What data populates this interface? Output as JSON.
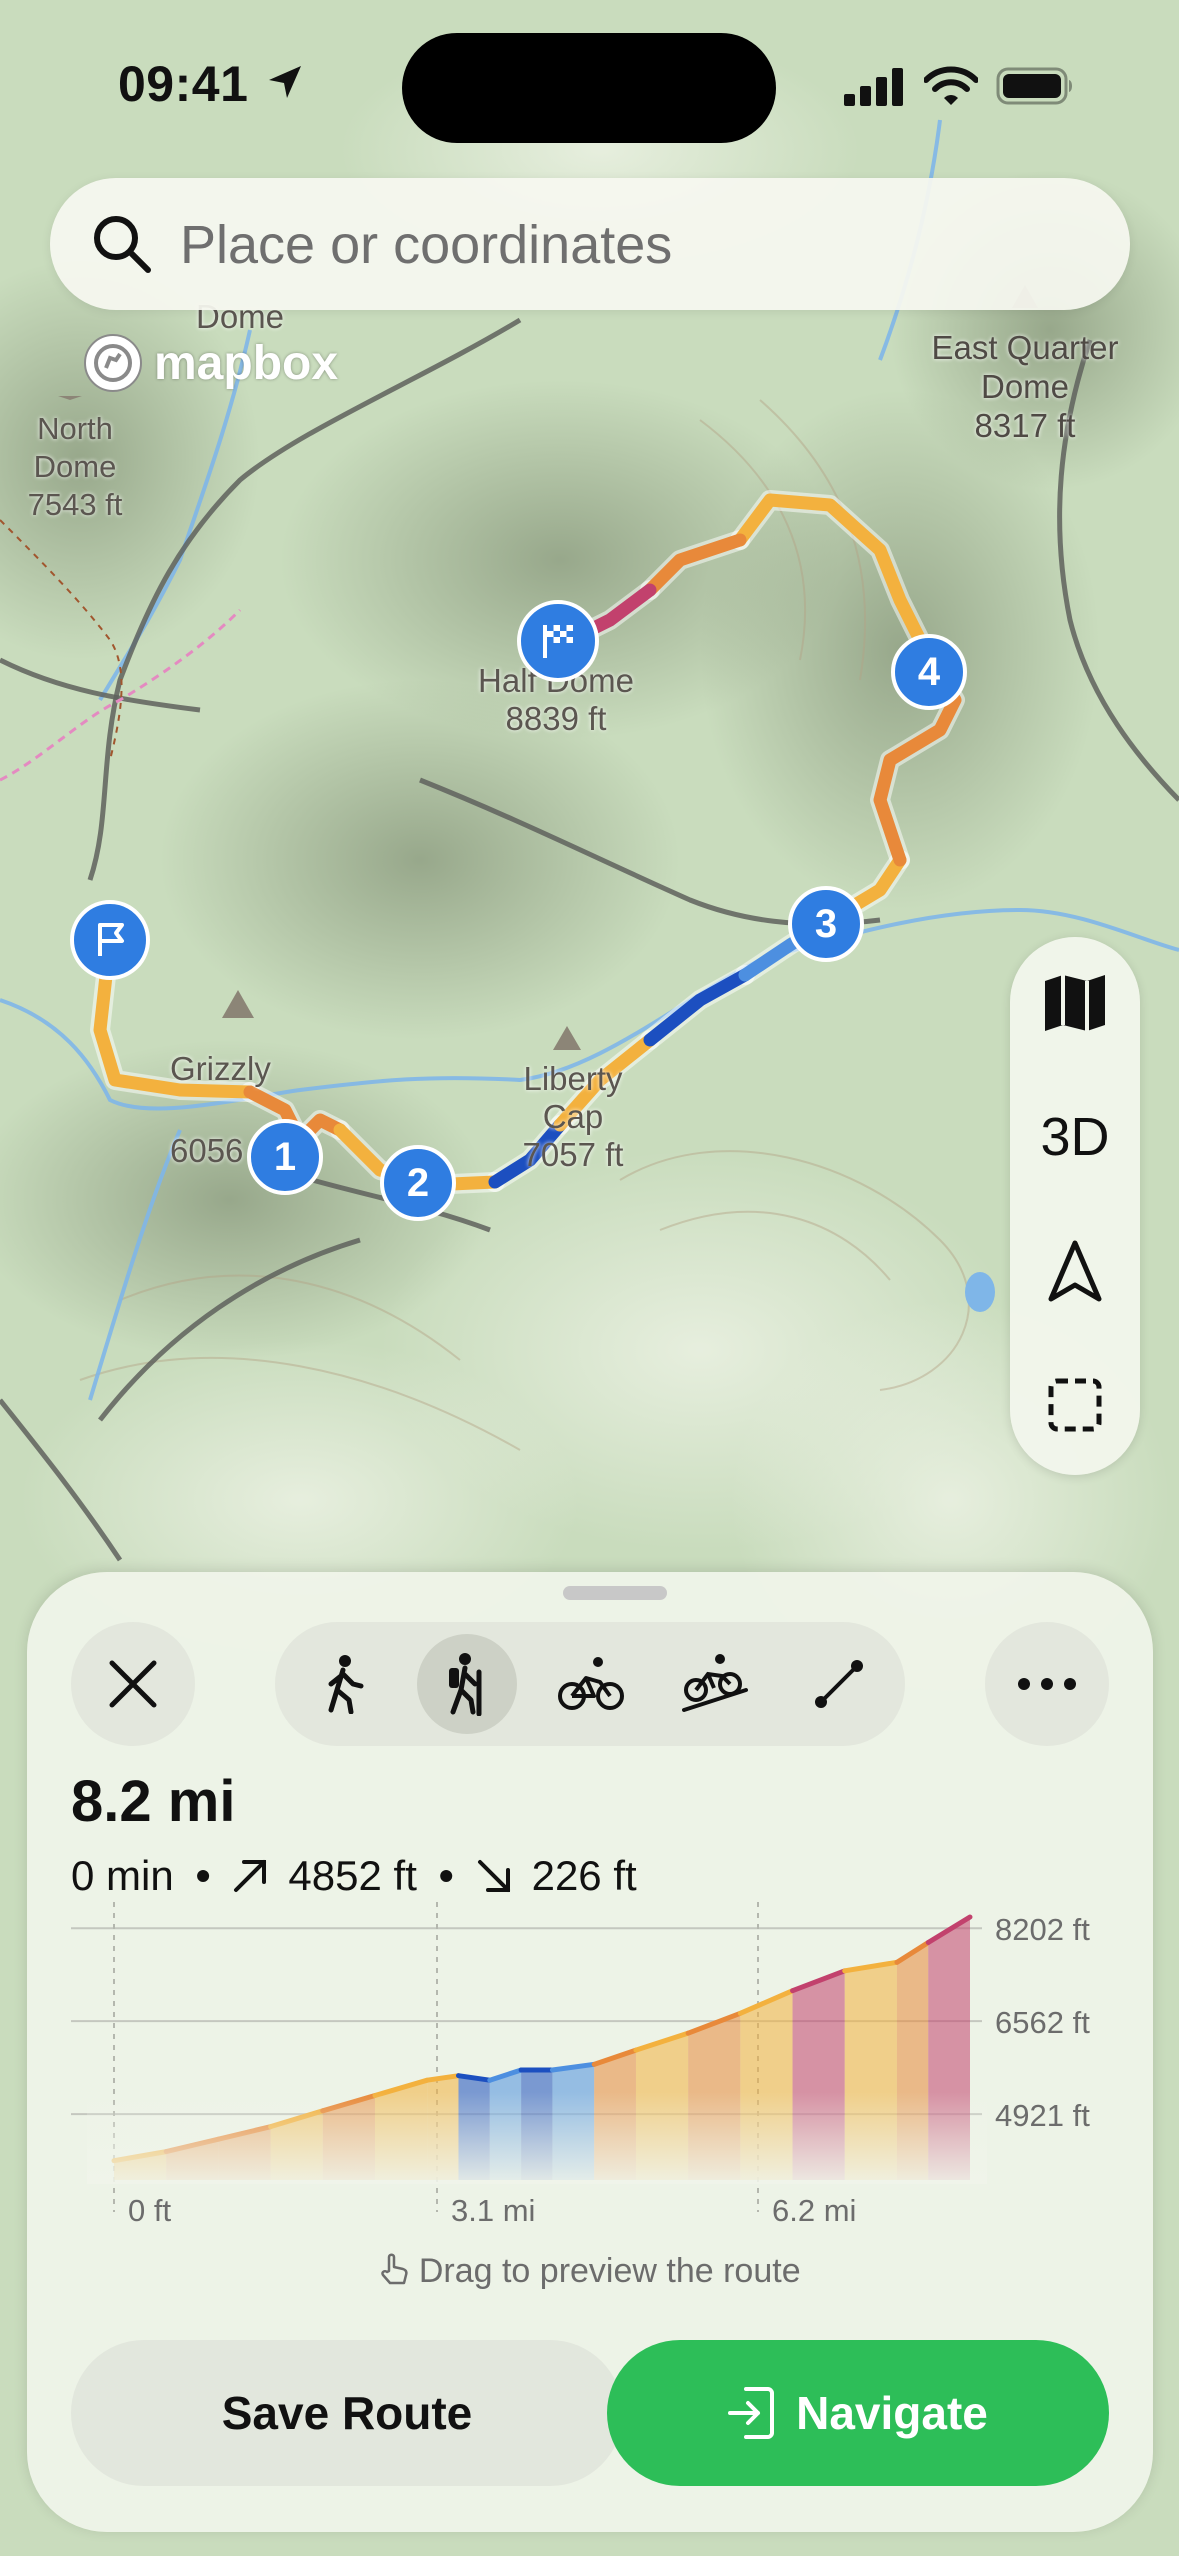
{
  "status_bar": {
    "time": "09:41"
  },
  "search": {
    "placeholder": "Place or coordinates"
  },
  "map": {
    "attribution": "mapbox",
    "peaks": [
      {
        "name": "Dome"
      },
      {
        "name": "North\nDome\n7543 ft"
      },
      {
        "name": "East Quarter\nDome\n8317 ft"
      },
      {
        "name": "Half Dome\n8839 ft"
      },
      {
        "name": "Grizzly\n6056"
      },
      {
        "name": "Liberty\nCap\n7057 ft"
      }
    ],
    "waypoints": [
      "1",
      "2",
      "3",
      "4"
    ],
    "route_colors": {
      "gentle": "#f3b13e",
      "moderate": "#e8893a",
      "steep": "#c2416d",
      "descent_steep": "#1c4fc0",
      "descent": "#4d8fe0"
    }
  },
  "map_tools": {
    "layers_icon": "map-layers-icon",
    "three_d_label": "3D",
    "locate_icon": "location-arrow-icon",
    "area_icon": "dashed-square-icon"
  },
  "route_sheet": {
    "modes": [
      "walking-icon",
      "hiking-icon",
      "cycling-icon",
      "mountain-bike-icon",
      "straight-line-icon"
    ],
    "selected_mode": "hiking-icon",
    "distance": "8.2 mi",
    "duration": "0 min",
    "ascent": "4852 ft",
    "descent": "226 ft",
    "hint": "Drag to preview the route",
    "save_label": "Save Route",
    "navigate_label": "Navigate"
  },
  "chart_data": {
    "type": "area",
    "title": "",
    "xlabel": "",
    "ylabel": "",
    "x_ticks": [
      "0 ft",
      "3.1 mi",
      "6.2 mi"
    ],
    "y_ticks": [
      "8202 ft",
      "6562 ft",
      "4921 ft"
    ],
    "x_unit": "mi",
    "y_unit": "ft",
    "xlim": [
      0,
      8.2
    ],
    "ylim": [
      3900,
      8400
    ],
    "grid": true,
    "x": [
      0,
      0.5,
      1.0,
      1.5,
      2.0,
      2.5,
      3.0,
      3.3,
      3.6,
      3.9,
      4.2,
      4.6,
      5.0,
      5.5,
      6.0,
      6.5,
      7.0,
      7.5,
      7.8,
      8.2
    ],
    "y": [
      4100,
      4260,
      4480,
      4700,
      4980,
      5250,
      5520,
      5600,
      5520,
      5700,
      5700,
      5800,
      6050,
      6350,
      6700,
      7100,
      7450,
      7600,
      7950,
      8400
    ],
    "colors": [
      "#f3b13e",
      "#e8893a",
      "#e8893a",
      "#f3b13e",
      "#e8893a",
      "#f3b13e",
      "#f3b13e",
      "#1c4fc0",
      "#4d8fe0",
      "#1c4fc0",
      "#4d8fe0",
      "#e8893a",
      "#f3b13e",
      "#e8893a",
      "#f3b13e",
      "#c2416d",
      "#f3b13e",
      "#e8893a",
      "#c2416d"
    ]
  }
}
